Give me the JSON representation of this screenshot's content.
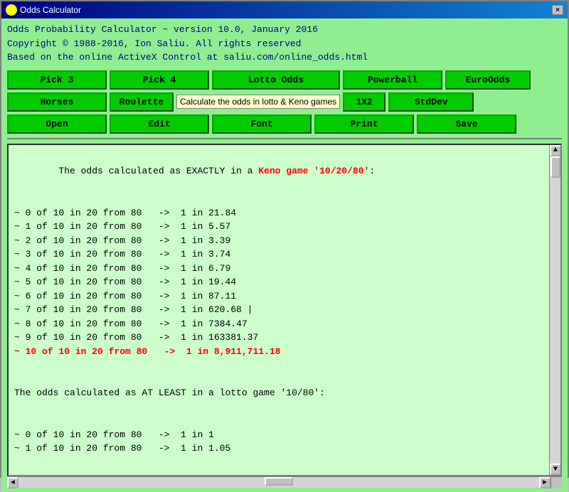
{
  "window": {
    "title": "Odds Calculator",
    "close_label": "×"
  },
  "header": {
    "line1": "Odds Probability Calculator ~ version 10.0, January 2016",
    "line2": "Copyright © 1988-2016, Ion Saliu. All rights reserved",
    "line3": "Based on the online ActiveX Control at saliu.com/online_odds.html"
  },
  "buttons_row1": {
    "pick3": "Pick 3",
    "pick4": "Pick 4",
    "lotto_odds": "Lotto Odds",
    "powerball": "Powerball",
    "euroodds": "EuroOdds"
  },
  "buttons_row2": {
    "horses": "Horses",
    "roulette": "Roulette",
    "tooltip": "Calculate the odds in lotto & Keno games",
    "1x2": "1X2",
    "stddev": "StdDev"
  },
  "buttons_row3": {
    "open": "Open",
    "edit": "Edit",
    "font": "Font",
    "print": "Print",
    "save": "Save"
  },
  "output": {
    "line1": "The odds calculated as EXACTLY in a ",
    "line1_red": "Keno game '10/20/80'",
    "line1_end": ":",
    "lines": [
      "~ 0 of 10 in 20 from 80   ->  1 in 21.84",
      "~ 1 of 10 in 20 from 80   ->  1 in 5.57",
      "~ 2 of 10 in 20 from 80   ->  1 in 3.39",
      "~ 3 of 10 in 20 from 80   ->  1 in 3.74",
      "~ 4 of 10 in 20 from 80   ->  1 in 6.79",
      "~ 5 of 10 in 20 from 80   ->  1 in 19.44",
      "~ 6 of 10 in 20 from 80   ->  1 in 87.11",
      "~ 7 of 10 in 20 from 80   ->  1 in 620.68 |",
      "~ 8 of 10 in 20 from 80   ->  1 in 7384.47",
      "~ 9 of 10 in 20 from 80   ->  1 in 163381.37"
    ],
    "line_red": "~ 10 of 10 in 20 from 80   ->  1 in 8,911,711.18",
    "separator": "",
    "line_at_least": "The odds calculated as AT LEAST in a lotto game '10/80':",
    "lines2": [
      "~ 0 of 10 in 20 from 80   ->  1 in 1",
      "~ 1 of 10 in 20 from 80   ->  1 in 1.05"
    ]
  },
  "scrollbar": {
    "up_arrow": "▲",
    "down_arrow": "▼",
    "left_arrow": "◄",
    "right_arrow": "►"
  }
}
